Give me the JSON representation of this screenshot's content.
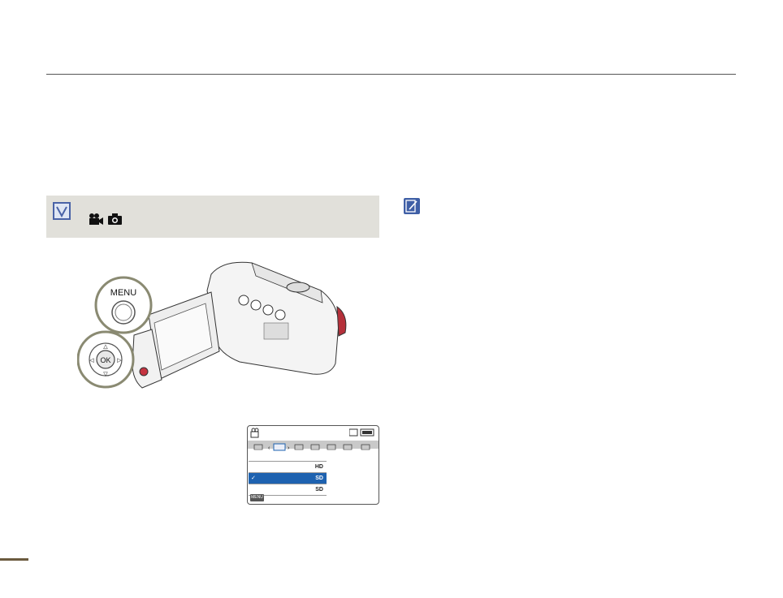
{
  "icons": {
    "check": "check-icon",
    "video_mode": "video-camera-icon",
    "photo_mode": "camera-icon",
    "note": "note-pencil-icon"
  },
  "camera_illustration": {
    "menu_label": "MENU",
    "ok_label": "OK"
  },
  "lcd": {
    "menu_button": "MENU",
    "items": [
      {
        "label": "",
        "quality": "",
        "selected": false
      },
      {
        "label": "",
        "quality": "HD",
        "selected": false
      },
      {
        "label": "✓",
        "quality": "SD",
        "selected": true
      },
      {
        "label": "",
        "quality": "SD",
        "selected": false
      }
    ]
  }
}
